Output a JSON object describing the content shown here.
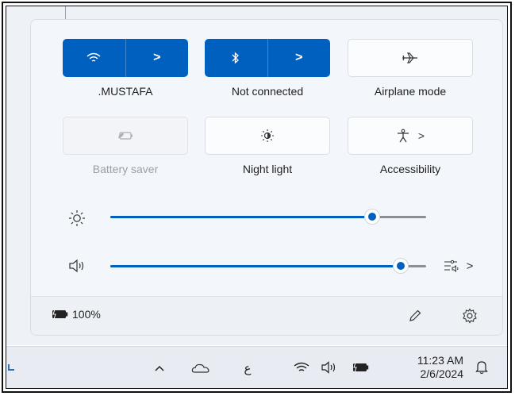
{
  "quick_settings": {
    "wifi": {
      "label": ".MUSTAFA",
      "icon": "wifi-icon"
    },
    "bluetooth": {
      "label": "Not connected",
      "icon": "bluetooth-icon"
    },
    "airplane": {
      "label": "Airplane mode",
      "icon": "airplane-icon"
    },
    "battery_saver": {
      "label": "Battery saver",
      "icon": "battery-saver-icon"
    },
    "night_light": {
      "label": "Night light",
      "icon": "night-light-icon"
    },
    "accessibility": {
      "label": "Accessibility",
      "icon": "accessibility-icon"
    },
    "chevron": ">"
  },
  "sliders": {
    "brightness": {
      "icon": "brightness-icon",
      "level": 0.83
    },
    "volume": {
      "icon": "speaker-icon",
      "level": 0.92
    }
  },
  "footer": {
    "battery_percent": "100%",
    "edit_icon": "pencil-icon",
    "settings_icon": "gear-icon"
  },
  "taskbar": {
    "ime_label": "ع",
    "time": "11:23 AM",
    "date": "2/6/2024"
  },
  "colors": {
    "accent": "#0060c0",
    "panel_bg": "#f3f6fb",
    "taskbar_bg": "#e8ebf1"
  }
}
